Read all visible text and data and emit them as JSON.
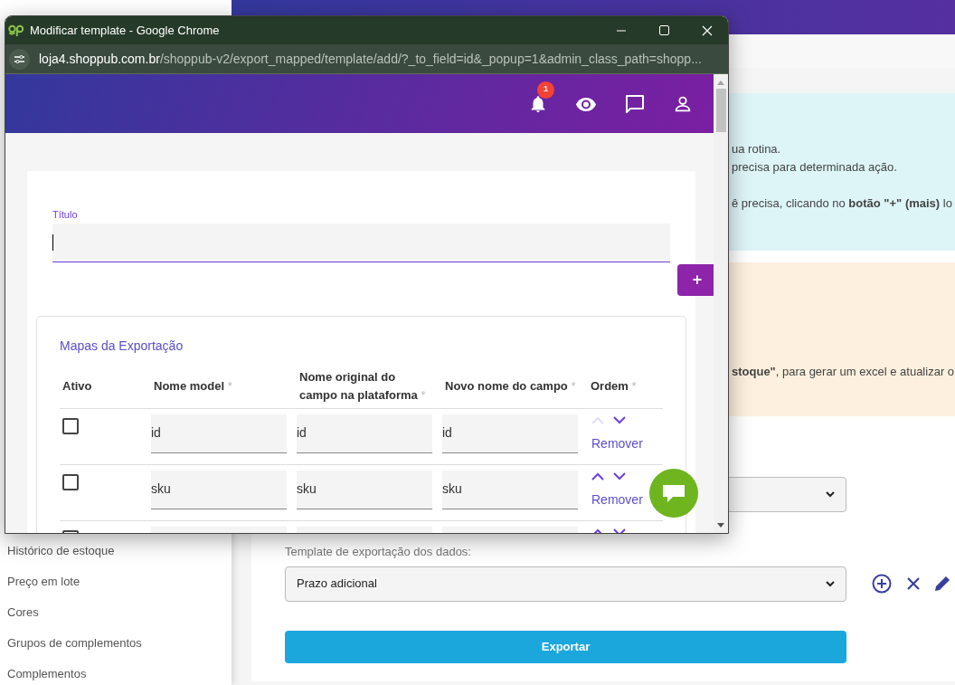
{
  "background_page": {
    "sidebar": {
      "items": [
        {
          "label": "Histórico de estoque"
        },
        {
          "label": "Preço em lote"
        },
        {
          "label": "Cores"
        },
        {
          "label": "Grupos de complementos"
        },
        {
          "label": "Complementos"
        }
      ]
    },
    "info_box": {
      "lines": [
        "ua rotina.",
        "precisa para determinada ação.",
        "ê precisa, clicando no **botão \"+\" (mais)** lo"
      ]
    },
    "warning_box": {
      "lines": [
        "**stoque\"**, para gerar um excel e atualizar o"
      ]
    },
    "template_field": {
      "label": "Template de exportação dos dados:",
      "value": "Prazo adicional"
    },
    "export_button": "Exportar"
  },
  "popup": {
    "title": "Modificar template - Google Chrome",
    "url_host": "loja4.shoppub.com.br",
    "url_path": "/shoppub-v2/export_mapped/template/add/?_to_field=id&_popup=1&admin_class_path=shopp...",
    "notification_count": "1",
    "title_field": {
      "label": "Título"
    },
    "add_button": "+",
    "maps": {
      "title": "Mapas da Exportação",
      "columns": [
        {
          "label": "Ativo"
        },
        {
          "label": "Nome model",
          "asterisk": "*"
        },
        {
          "label": "Nome original do campo na plataforma",
          "asterisk": "*"
        },
        {
          "label": "Novo nome do campo",
          "asterisk": "*"
        },
        {
          "label": "Ordem",
          "asterisk": "*"
        }
      ],
      "rows": [
        {
          "checked": false,
          "can_move_up": false,
          "values": [
            "id",
            "id",
            "id"
          ],
          "remove": "Remover"
        },
        {
          "checked": false,
          "can_move_up": true,
          "values": [
            "sku",
            "sku",
            "sku"
          ],
          "remove": "Remover"
        },
        {
          "checked": false,
          "can_move_up": true
        }
      ]
    }
  }
}
